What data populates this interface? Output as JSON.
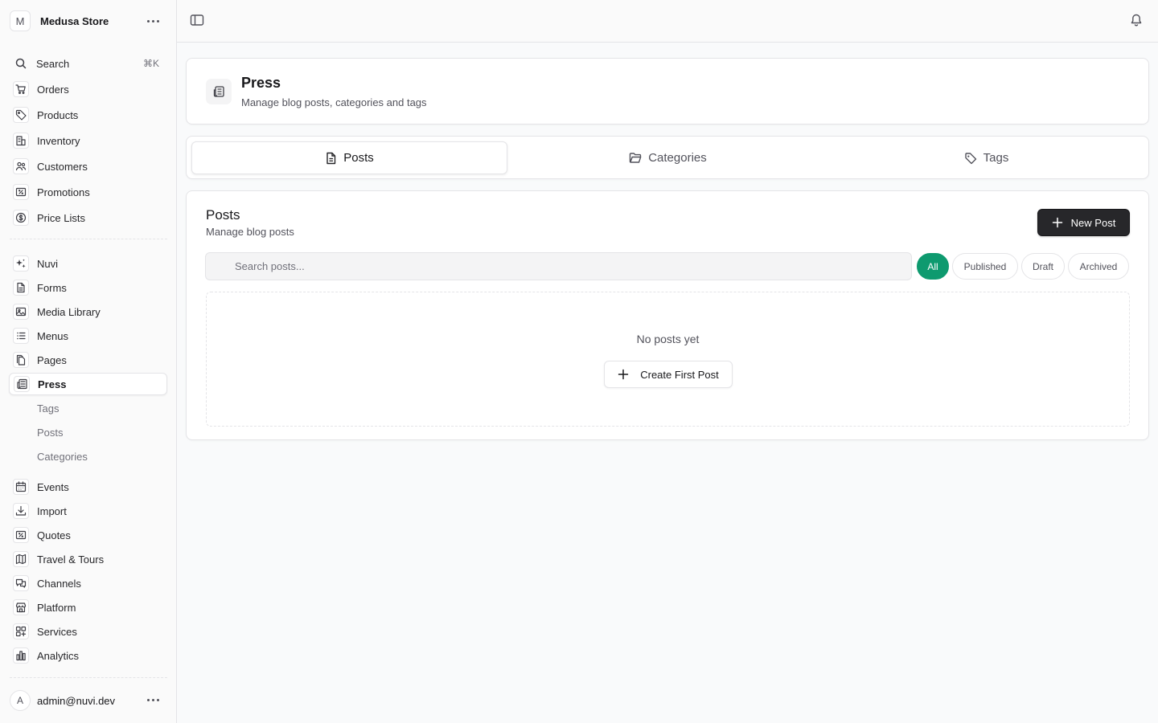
{
  "store": {
    "initial": "M",
    "name": "Medusa Store"
  },
  "search": {
    "label": "Search",
    "shortcut": "⌘K"
  },
  "nav_main": [
    {
      "label": "Orders",
      "icon": "cart-icon"
    },
    {
      "label": "Products",
      "icon": "tag-icon"
    },
    {
      "label": "Inventory",
      "icon": "building-icon"
    },
    {
      "label": "Customers",
      "icon": "users-icon"
    },
    {
      "label": "Promotions",
      "icon": "receipt-percent-icon"
    },
    {
      "label": "Price Lists",
      "icon": "currency-dollar-icon"
    }
  ],
  "nav_extensions": [
    {
      "label": "Nuvi",
      "icon": "sparkles-icon"
    },
    {
      "label": "Forms",
      "icon": "document-icon"
    },
    {
      "label": "Media Library",
      "icon": "photo-icon"
    },
    {
      "label": "Menus",
      "icon": "list-icon"
    },
    {
      "label": "Pages",
      "icon": "documents-icon"
    },
    {
      "label": "Press",
      "icon": "newspaper-icon",
      "active": true
    }
  ],
  "press_sub": [
    "Tags",
    "Posts",
    "Categories"
  ],
  "nav_more": [
    {
      "label": "Events",
      "icon": "calendar-icon"
    },
    {
      "label": "Import",
      "icon": "download-icon"
    },
    {
      "label": "Quotes",
      "icon": "receipt-percent-icon"
    },
    {
      "label": "Travel & Tours",
      "icon": "map-icon"
    },
    {
      "label": "Channels",
      "icon": "chat-icon"
    },
    {
      "label": "Platform",
      "icon": "store-icon"
    },
    {
      "label": "Services",
      "icon": "grid-plus-icon"
    },
    {
      "label": "Analytics",
      "icon": "bar-chart-icon"
    }
  ],
  "user": {
    "initial": "A",
    "email": "admin@nuvi.dev"
  },
  "header": {
    "title": "Press",
    "subtitle": "Manage blog posts, categories and tags"
  },
  "tabs": [
    {
      "label": "Posts",
      "icon": "document-icon",
      "active": true
    },
    {
      "label": "Categories",
      "icon": "folder-icon"
    },
    {
      "label": "Tags",
      "icon": "tag-icon"
    }
  ],
  "posts": {
    "title": "Posts",
    "subtitle": "Manage blog posts",
    "new_button": "New Post",
    "search_placeholder": "Search posts...",
    "search_value": "",
    "filters": [
      {
        "label": "All",
        "active": true
      },
      {
        "label": "Published"
      },
      {
        "label": "Draft"
      },
      {
        "label": "Archived"
      }
    ],
    "empty_text": "No posts yet",
    "create_button": "Create First Post"
  },
  "colors": {
    "accent": "#0e9a6f",
    "primary_button": "#27272a"
  }
}
